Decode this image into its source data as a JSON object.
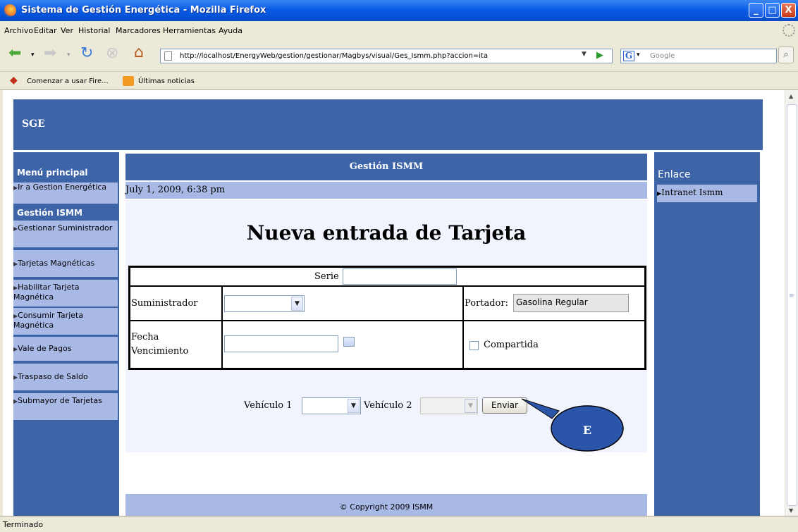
{
  "window": {
    "title": "Sistema de Gestión Energética - Mozilla Firefox",
    "minimize": "_",
    "maximize": "□",
    "close": "X"
  },
  "menu": [
    "Archivo",
    "Editar",
    "Ver",
    "Historial",
    "Marcadores",
    "Herramientas",
    "Ayuda"
  ],
  "toolbar": {
    "url": "http://localhost/EnergyWeb/gestion/gestionar/Magbys/visual/Ges_Ismm.php?accion=ita",
    "search_placeholder": "Google"
  },
  "bookmarks": [
    "Comenzar a usar Fire...",
    "Últimas noticias"
  ],
  "page": {
    "site_title": "SGE",
    "left_menu": {
      "title": "Menú principal",
      "item_gestion": "Ir a Gestion Energética",
      "section": "Gestión ISMM",
      "items": [
        "Gestionar Suministrador",
        "Tarjetas Magnéticas",
        "Habilitar Tarjeta Magnética",
        "Consumir Tarjeta Magnética",
        "Vale de Pagos",
        "Traspaso de Saldo",
        "Submayor de Tarjetas"
      ]
    },
    "center": {
      "header": "Gestión ISMM",
      "date": "July 1, 2009, 6:38 pm",
      "heading": "Nueva entrada de Tarjeta",
      "form": {
        "serie_label": "Serie",
        "serie_value": "",
        "suministrador_label": "Suministrador",
        "suministrador_value": "",
        "portador_label": "Portador:",
        "portador_value": "Gasolina Regular",
        "fecha_label": "Fecha Vencimiento",
        "fecha_value": "",
        "compartida_label": "Compartida",
        "compartida_checked": false,
        "vehiculo1_label": "Vehículo 1",
        "vehiculo2_label": "Vehículo 2",
        "submit_label": "Enviar"
      },
      "callout_label": "E",
      "footer": "© Copyright 2009 ISMM"
    },
    "right": {
      "title": "Enlace",
      "link": "Intranet Ismm"
    }
  },
  "status": "Terminado",
  "colors": {
    "header_blue": "#3e64a8",
    "light_blue": "#a8b9e6",
    "callout": "#2b55a8"
  }
}
